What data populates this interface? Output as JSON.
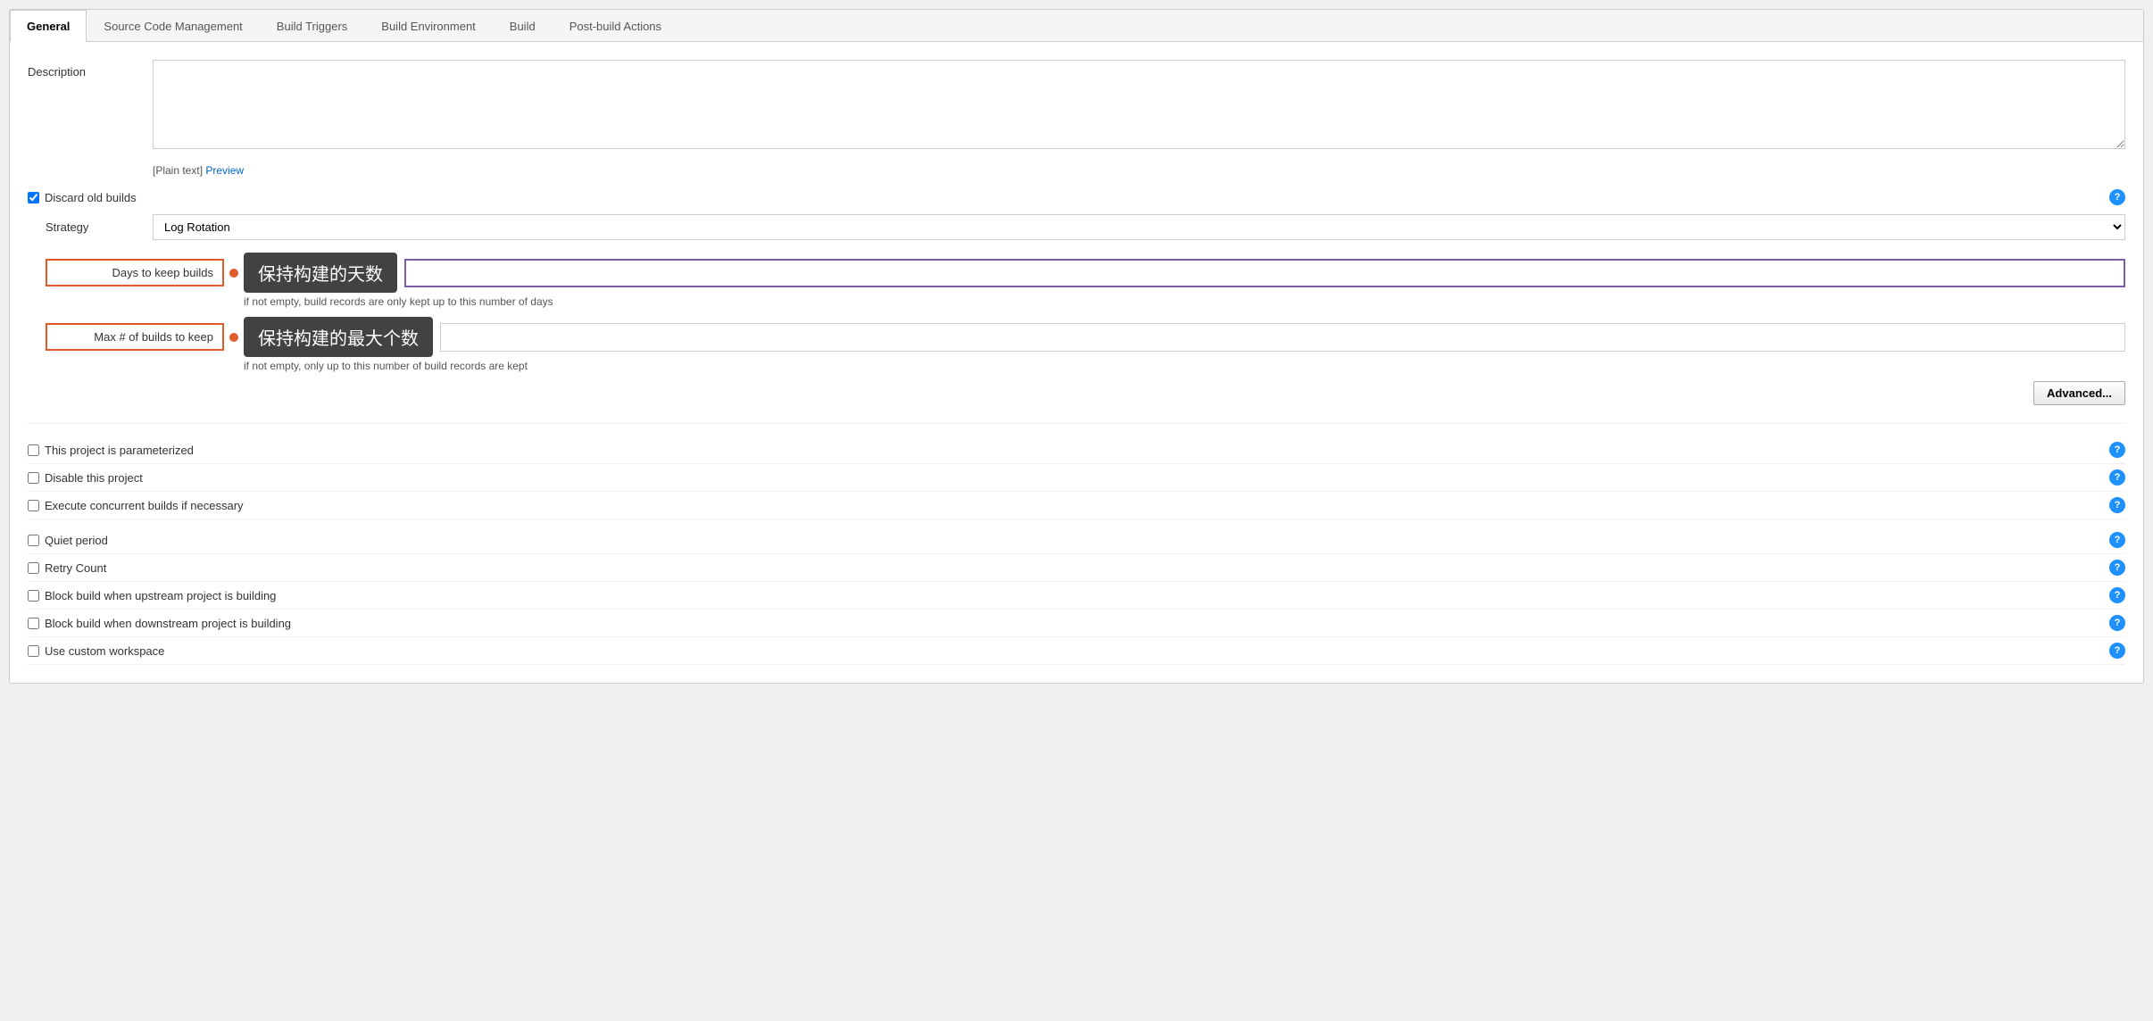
{
  "tabs": [
    {
      "id": "general",
      "label": "General",
      "active": true
    },
    {
      "id": "scm",
      "label": "Source Code Management",
      "active": false
    },
    {
      "id": "triggers",
      "label": "Build Triggers",
      "active": false
    },
    {
      "id": "environment",
      "label": "Build Environment",
      "active": false
    },
    {
      "id": "build",
      "label": "Build",
      "active": false
    },
    {
      "id": "postbuild",
      "label": "Post-build Actions",
      "active": false
    }
  ],
  "description": {
    "label": "Description",
    "value": "",
    "format_text": "[Plain text]",
    "preview_link": "Preview"
  },
  "discard_builds": {
    "label": "Discard old builds",
    "checked": true
  },
  "strategy": {
    "label": "Strategy",
    "value": "Log Rotation",
    "options": [
      "Log Rotation"
    ]
  },
  "days_to_keep": {
    "label": "Days to keep builds",
    "tooltip": "保持构建的天数",
    "hint": "if not empty, build records are only kept up to this number of days",
    "value": ""
  },
  "max_builds": {
    "label": "Max # of builds to keep",
    "tooltip": "保持构建的最大个数",
    "hint": "if not empty, only up to this number of build records are kept",
    "value": ""
  },
  "advanced_btn": "Advanced...",
  "options": [
    {
      "id": "parameterized",
      "label": "This project is parameterized",
      "checked": false
    },
    {
      "id": "disable",
      "label": "Disable this project",
      "checked": false
    },
    {
      "id": "concurrent",
      "label": "Execute concurrent builds if necessary",
      "checked": false
    }
  ],
  "options2": [
    {
      "id": "quiet",
      "label": "Quiet period",
      "checked": false
    },
    {
      "id": "retry",
      "label": "Retry Count",
      "checked": false
    },
    {
      "id": "block_upstream",
      "label": "Block build when upstream project is building",
      "checked": false
    },
    {
      "id": "block_downstream",
      "label": "Block build when downstream project is building",
      "checked": false
    },
    {
      "id": "custom_workspace",
      "label": "Use custom workspace",
      "checked": false
    }
  ]
}
